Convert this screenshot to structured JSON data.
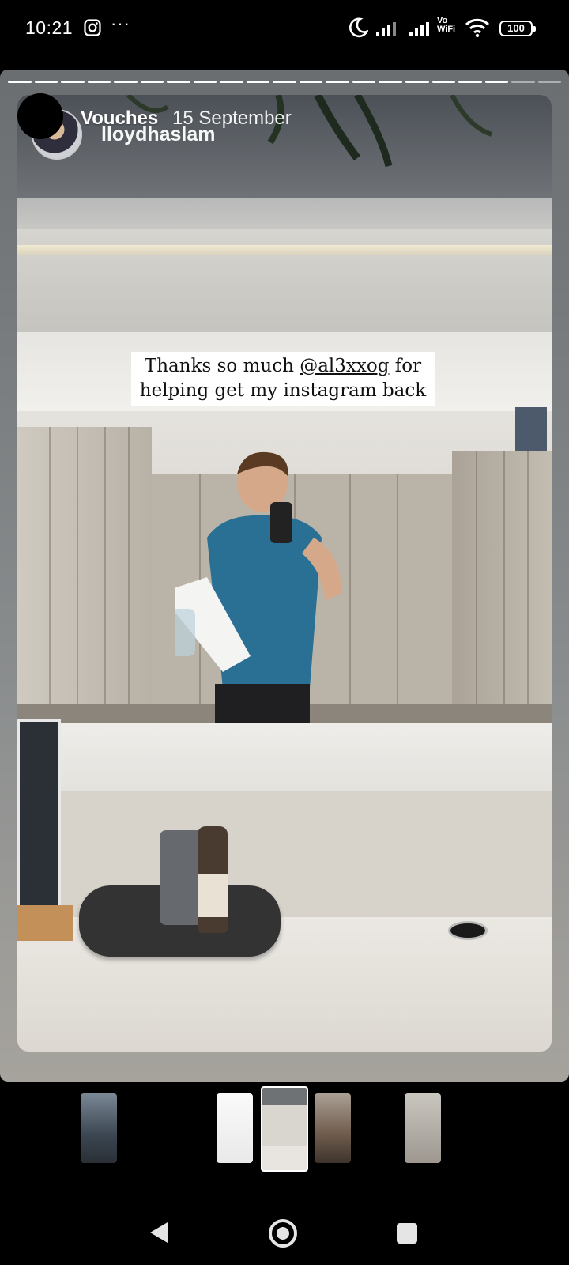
{
  "status_bar": {
    "time": "10:21",
    "more": "···",
    "vo_wifi_top": "Vo",
    "vo_wifi_bottom": "WiFi",
    "battery": "100"
  },
  "story": {
    "progress_segments_total": 21,
    "progress_segments_viewed": 19,
    "header": {
      "name": "Vouches",
      "date": "15 September",
      "shared_from": "lloydhaslam"
    },
    "caption": {
      "before": "Thanks so much ",
      "mention": "@al3xxog",
      "after_line1": " for",
      "line2": "helping get my instagram back"
    }
  },
  "colors": {
    "background": "#000000",
    "card": "#8a8d8e",
    "accent_white": "#ffffff"
  },
  "thumbnails": [
    "story-1",
    "story-2",
    "story-3-current",
    "story-4",
    "story-5"
  ]
}
